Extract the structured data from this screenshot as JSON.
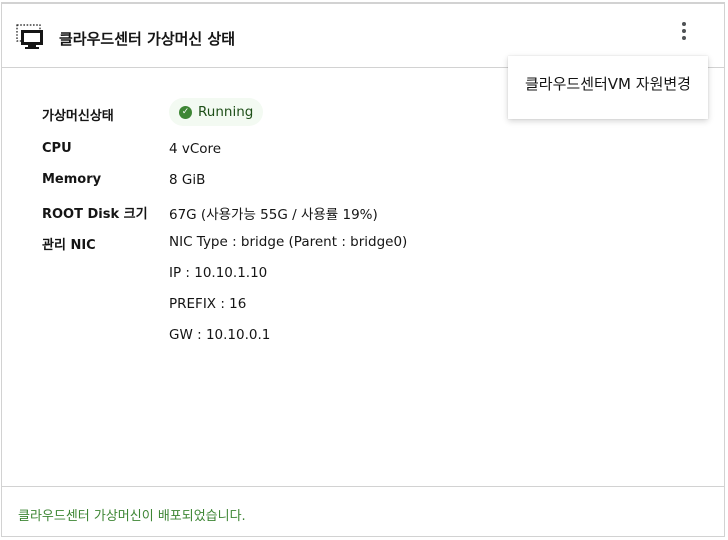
{
  "header": {
    "title": "클라우드센터 가상머신 상태",
    "icon": "virtual-machine-icon",
    "menu_icon": "kebab-menu-icon"
  },
  "dropdown": {
    "items": [
      "클라우드센터VM 자원변경"
    ]
  },
  "details": {
    "status": {
      "label": "가상머신상태",
      "value": "Running",
      "color": "#3e8635"
    },
    "cpu": {
      "label": "CPU",
      "value": "4 vCore"
    },
    "memory": {
      "label": "Memory",
      "value": "8 GiB"
    },
    "root_disk": {
      "label": "ROOT Disk 크기",
      "value": "67G (사용가능 55G / 사용률 19%)"
    },
    "nic": {
      "label": "관리 NIC",
      "lines": [
        "NIC Type : bridge (Parent : bridge0)",
        "IP : 10.10.1.10",
        "PREFIX : 16",
        "GW : 10.10.0.1"
      ]
    }
  },
  "footer": {
    "message": "클라우드센터 가상머신이 배포되었습니다.",
    "color": "#3e8635"
  }
}
